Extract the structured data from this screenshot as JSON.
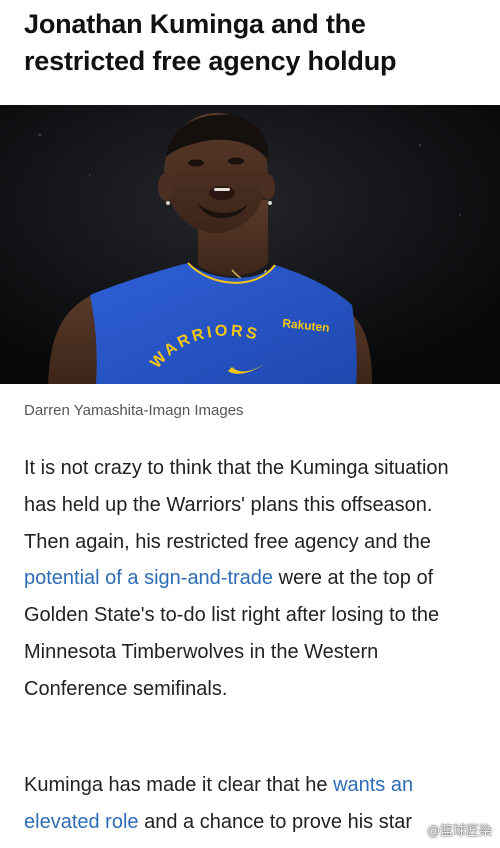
{
  "article": {
    "headline": "Jonathan Kuminga and the restricted free agency holdup",
    "photo_caption": "Darren Yamashita-Imagn Images",
    "paragraph_1": {
      "part_1": "It is not crazy to think that the Kuminga situation has held up the Warriors' plans this offseason. Then again, his restricted free agency and the ",
      "link_1": "potential of a sign-and-trade",
      "part_2": " were at the top of Golden State's to-do list right after losing to the Minnesota Timberwolves in the Western Conference semifinals."
    },
    "paragraph_2": {
      "part_1": "Kuminga has made it clear that he ",
      "link_1": "wants an elevated role",
      "part_2": " and a chance to prove his star"
    }
  },
  "photo": {
    "jersey_sponsor": "Rakuten",
    "jersey_text": "WARRIORS",
    "jersey_color": "#2a58c9",
    "jersey_text_color": "#f5c518"
  },
  "watermark": {
    "text": "@篮球匠染"
  },
  "colors": {
    "link": "#2d6db5",
    "body_text": "#222222",
    "caption": "#555555",
    "headline": "#111111"
  }
}
